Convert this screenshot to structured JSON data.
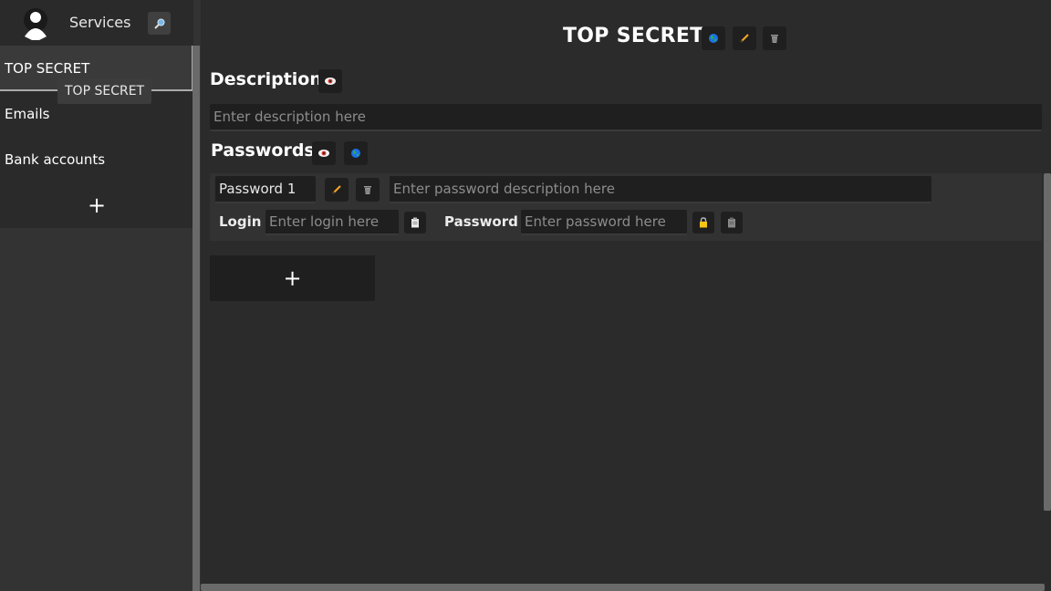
{
  "sidebar": {
    "title": "Services",
    "items": [
      {
        "label": "TOP SECRET"
      },
      {
        "label": "Emails"
      },
      {
        "label": "Bank accounts"
      }
    ],
    "add_label": "+",
    "tooltip": "TOP SECRET"
  },
  "collapse": {
    "arrow1": ">",
    "arrow2": ">"
  },
  "main": {
    "title": "TOP SECRET",
    "description": {
      "label": "Description",
      "placeholder": "Enter description here"
    },
    "passwords": {
      "label": "Passwords",
      "entry": {
        "name": "Password 1",
        "description_placeholder": "Enter password description here",
        "login_label": "Login",
        "login_placeholder": "Enter login here",
        "password_label": "Password",
        "password_placeholder": "Enter password here"
      },
      "add_label": "+"
    }
  },
  "icons": {
    "avatar": "user-icon",
    "search": "search-icon",
    "globe": "globe-icon",
    "edit": "pencil-icon",
    "delete": "trash-icon",
    "visibility": "eye-icon",
    "copy": "clipboard-icon",
    "lock": "lock-icon"
  },
  "colors": {
    "accent_pencil": "#f5a623",
    "lock": "#f5c518",
    "eye_red": "#d9342b",
    "globe_blue": "#1a73e8",
    "globe_green": "#34a853"
  }
}
